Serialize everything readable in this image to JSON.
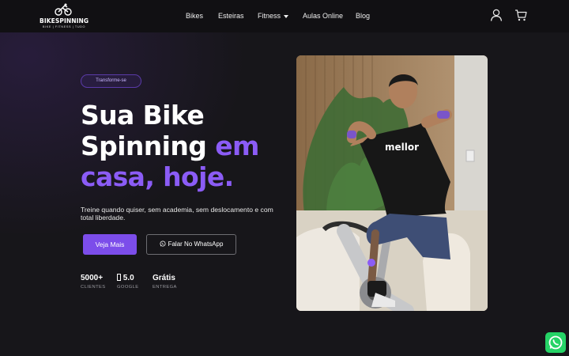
{
  "header": {
    "logo": {
      "title_part1": "BIKE",
      "title_part2": "SPINNING",
      "subtitle": "BIKE | FITNESS | TUDO"
    },
    "nav": [
      {
        "label": "Bikes"
      },
      {
        "label": "Esteiras"
      },
      {
        "label": "Fitness",
        "has_dropdown": true
      },
      {
        "label": "Aulas Online"
      },
      {
        "label": "Blog"
      }
    ],
    "icons": [
      "user-icon",
      "cart-icon"
    ]
  },
  "hero": {
    "badge": "Transforme-se",
    "headline": {
      "line1": "Sua Bike",
      "line2_white": "Spinning",
      "line2_accent": "em",
      "line3_accent": "casa, hoje."
    },
    "description": "Treine quando quiser, sem academia, sem deslocamento e com total liberdade.",
    "primary_button": "Veja Mais",
    "secondary_button": "Falar No WhatsApp",
    "stats": [
      {
        "value": "5000+",
        "label": "CLIENTES"
      },
      {
        "value": " 5.0",
        "label": "GOOGLE"
      },
      {
        "value": "Grátis",
        "label": "ENTREGA"
      }
    ],
    "photo": {
      "shirt_text": "mellor"
    }
  },
  "colors": {
    "accent": "#8b5cf6",
    "button": "#7c4dea",
    "background": "#17161a",
    "whatsapp": "#25d366"
  }
}
